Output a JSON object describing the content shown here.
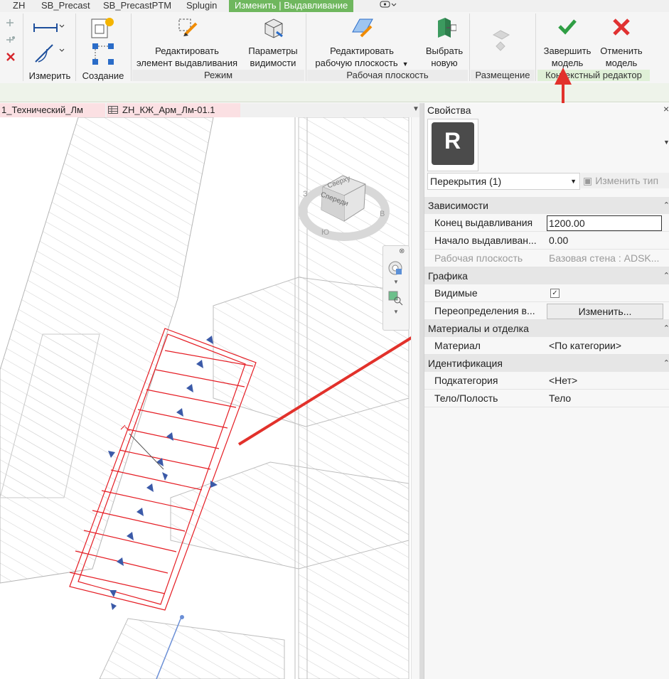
{
  "ribbon_tabs": [
    "ZH",
    "SB_Precast",
    "SB_PrecastPTM",
    "Splugin",
    "Изменить | Выдавливание"
  ],
  "ribbon": {
    "panels": {
      "measure": "Измерить",
      "create": "Создание",
      "mode": "Режим",
      "workplane": "Рабочая плоскость",
      "placement": "Размещение",
      "context_editor": "Контекстный редактор"
    },
    "buttons": {
      "edit_extrusion": [
        "Редактировать",
        "элемент выдавливания"
      ],
      "visibility_params": [
        "Параметры",
        "видимости"
      ],
      "edit_workplane": [
        "Редактировать",
        "рабочую плоскость"
      ],
      "pick_new": [
        "Выбрать",
        "новую"
      ],
      "finish_model": [
        "Завершить",
        "модель"
      ],
      "cancel_model": [
        "Отменить",
        "модель"
      ]
    }
  },
  "view_tabs": [
    "1_Технический_Лм",
    "ZH_КЖ_Арм_Лм-01.1"
  ],
  "viewcube": {
    "top": "Сверху",
    "front": "Спереди",
    "compass_w": "З",
    "compass_s": "Ю",
    "compass_e": "В"
  },
  "properties": {
    "title": "Свойства",
    "logo_letter": "R",
    "type_selector": "Перекрытия (1)",
    "edit_type": "Изменить тип",
    "groups": [
      {
        "name": "Зависимости",
        "rows": [
          {
            "key": "Конец выдавливания",
            "value": "1200.00",
            "editable": true
          },
          {
            "key": "Начало выдавливан...",
            "value": "0.00"
          },
          {
            "key": "Рабочая плоскость",
            "value": "Базовая стена : ADSK...",
            "disabled": true
          }
        ]
      },
      {
        "name": "Графика",
        "rows": [
          {
            "key": "Видимые",
            "value": "",
            "checkbox": true
          },
          {
            "key": "Переопределения в...",
            "value": "Изменить...",
            "button": true
          }
        ]
      },
      {
        "name": "Материалы и отделка",
        "rows": [
          {
            "key": "Материал",
            "value": "<По категории>"
          }
        ]
      },
      {
        "name": "Идентификация",
        "rows": [
          {
            "key": "Подкатегория",
            "value": "<Нет>"
          },
          {
            "key": "Тело/Полость",
            "value": "Тело"
          }
        ]
      }
    ]
  },
  "colors": {
    "accent": "#6fb75e",
    "annotation": "#e2312b",
    "selection": "#e51c23",
    "grip": "#3b5aa8"
  }
}
